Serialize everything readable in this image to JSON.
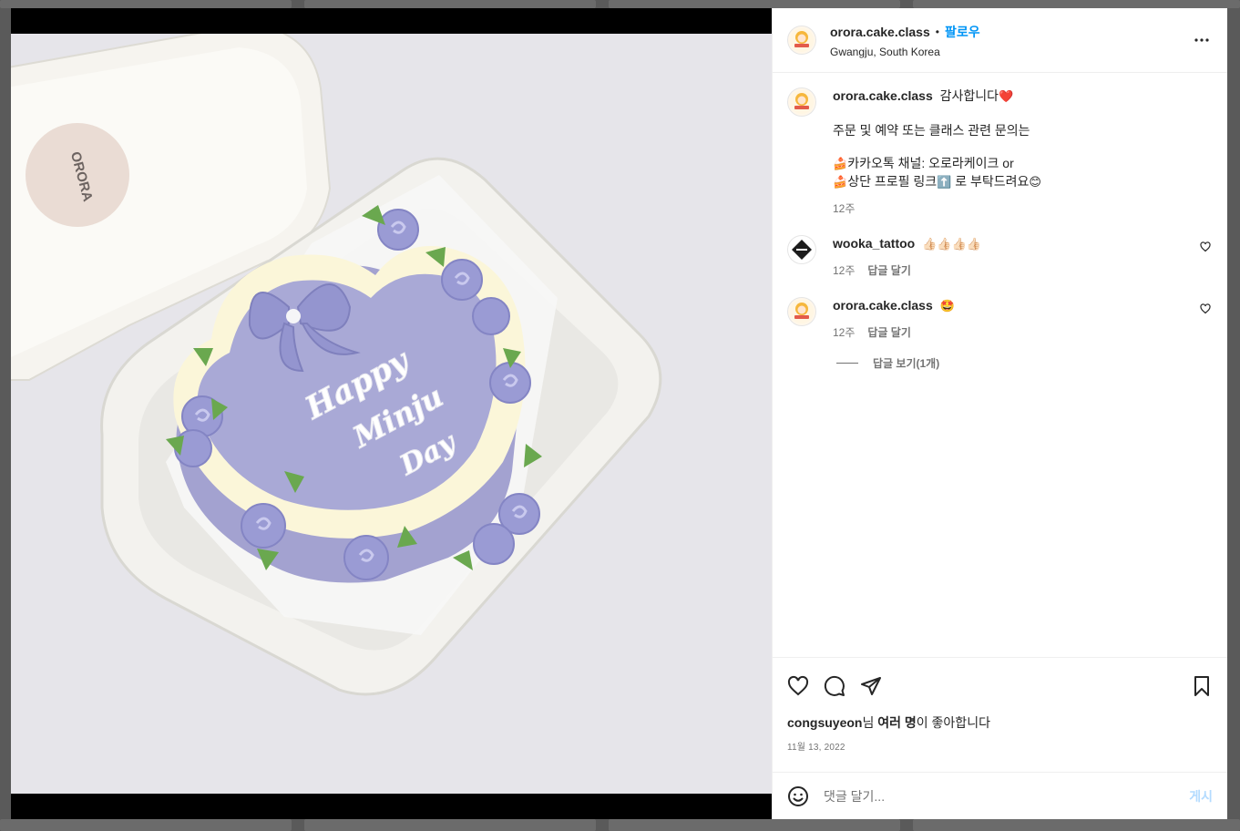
{
  "post": {
    "account": {
      "username": "orora.cake.class",
      "dot": "•",
      "follow_label": "팔로우",
      "location": "Gwangju, South Korea",
      "avatar_text": "ORORA"
    },
    "image": {
      "cake_text_line1": "Happy",
      "cake_text_line2": "Minju",
      "cake_text_line3": "Day",
      "box_logo": "ORORA"
    },
    "caption": {
      "username": "orora.cake.class",
      "line1": "감사합니다",
      "line2": "주문 및 예약 또는 클래스 관련 문의는",
      "line3": "카카오톡 채널: 오로라케이크   or",
      "line4a": "상단 프로필 링크",
      "line4b": " 로 부탁드려요",
      "time": "12주"
    },
    "comments": [
      {
        "username": "wooka_tattoo",
        "text": "👍🏻👍🏻👍🏻👍🏻",
        "time": "12주",
        "reply_label": "답글 달기"
      },
      {
        "username": "orora.cake.class",
        "text": "🤩",
        "time": "12주",
        "reply_label": "답글 달기",
        "view_replies": "답글 보기(1개)"
      }
    ],
    "likes": {
      "user": "congsuyeon",
      "suffix1": "님 ",
      "others": "여러 명",
      "suffix2": "이 좋아합니다"
    },
    "date": "11월 13, 2022",
    "add_comment": {
      "placeholder": "댓글 달기...",
      "post_label": "게시"
    },
    "colors": {
      "accent": "#0095f6",
      "cake_lavender": "#9a9bd4",
      "cream": "#fbf6d9",
      "leaf": "#6aa84f"
    }
  }
}
